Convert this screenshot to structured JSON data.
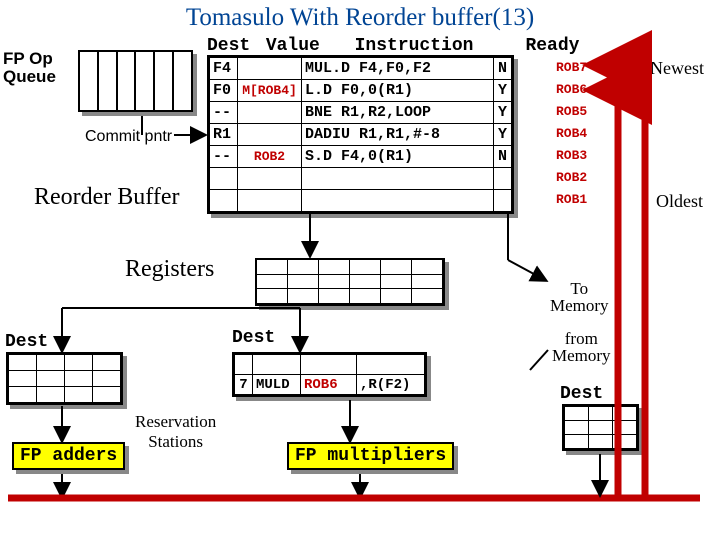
{
  "title": "Tomasulo With Reorder buffer(13)",
  "fp_op_queue": {
    "label": "FP Op\nQueue"
  },
  "commit_pointer": "Commit pntr",
  "rob_header": {
    "dest": "Dest",
    "value": "Value",
    "instruction": "Instruction",
    "ready": "Ready"
  },
  "rob_rows": [
    {
      "dest": "F4",
      "value": "",
      "inst": "MUL.D F4,F0,F2",
      "ready": "N",
      "tag": "ROB7"
    },
    {
      "dest": "F0",
      "value": "M[ROB4]",
      "inst": "L.D F0,0(R1)",
      "ready": "Y",
      "tag": "ROB6"
    },
    {
      "dest": "--",
      "value": "",
      "inst": "BNE R1,R2,LOOP",
      "ready": "Y",
      "tag": "ROB5"
    },
    {
      "dest": "R1",
      "value": "",
      "inst": "DADIU R1,R1,#-8",
      "ready": "Y",
      "tag": "ROB4"
    },
    {
      "dest": "--",
      "value": "ROB2",
      "inst": "S.D F4,0(R1)",
      "ready": "N",
      "tag": "ROB3"
    },
    {
      "dest": "",
      "value": "",
      "inst": "",
      "ready": "",
      "tag": "ROB2"
    },
    {
      "dest": "",
      "value": "",
      "inst": "",
      "ready": "",
      "tag": "ROB1"
    }
  ],
  "newest": "Newest",
  "oldest": "Oldest",
  "reorder_buffer": "Reorder Buffer",
  "registers_label": "Registers",
  "labels": {
    "dest": "Dest",
    "reservation_stations": "Reservation\nStations",
    "to_memory": "To\nMemory",
    "from_memory": "from\nMemory",
    "fp_adders": "FP adders",
    "fp_multipliers": "FP multipliers"
  },
  "rs_mid": {
    "rows": [
      {
        "n": "",
        "op": "",
        "a": "",
        "b": ""
      },
      {
        "n": "7",
        "op": "MULD",
        "a": "ROB6",
        "b": ",R(F2)"
      }
    ]
  }
}
